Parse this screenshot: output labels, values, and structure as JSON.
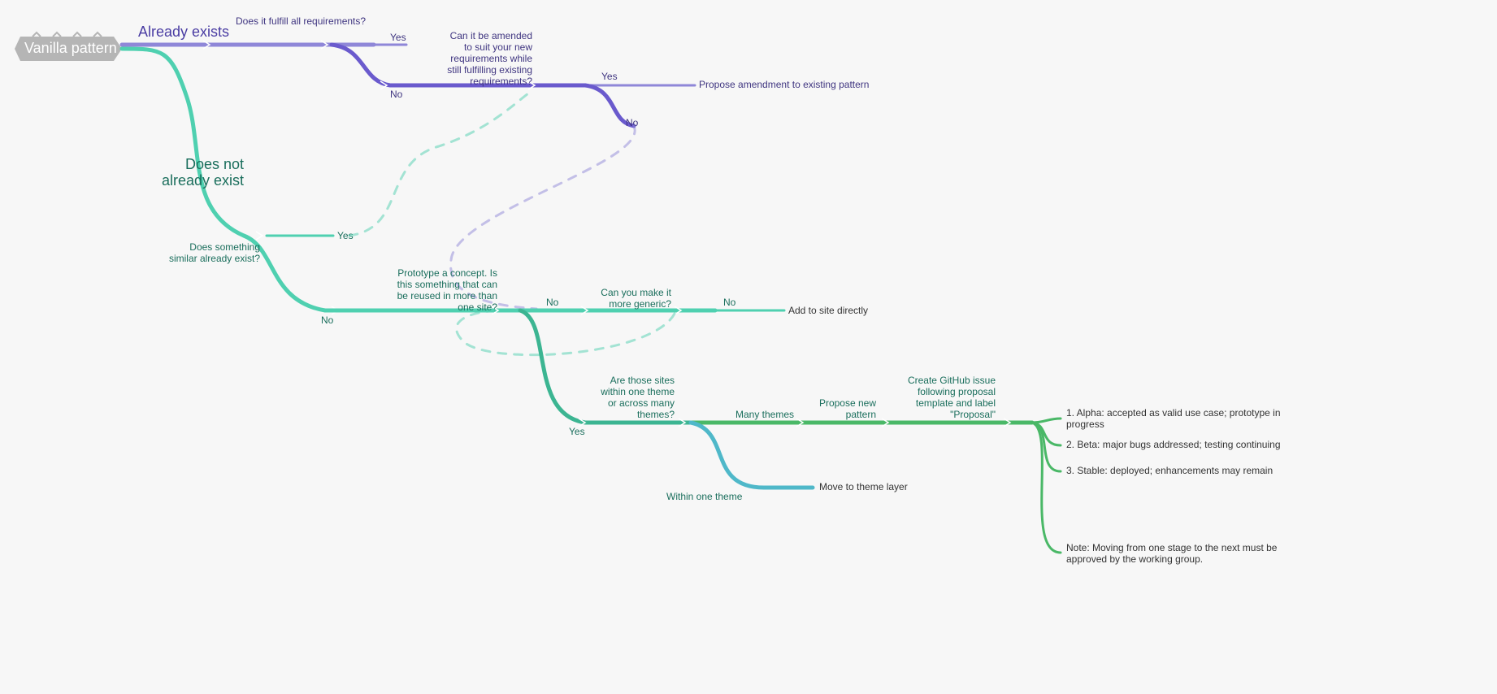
{
  "root": {
    "label": "Vanilla pattern"
  },
  "branch_exists": {
    "label": "Already exists",
    "q_fulfill": "Does it fulfill all requirements?",
    "yes1": "Yes",
    "q_amend_l1": "Can it be amended",
    "q_amend_l2": "to suit your new",
    "q_amend_l3": "requirements while",
    "q_amend_l4": "still fulfilling existing",
    "q_amend_l5": "requirements?",
    "no1": "No",
    "yes2": "Yes",
    "no2": "No",
    "propose_amend": "Propose amendment to existing pattern"
  },
  "branch_notexists": {
    "label_l1": "Does not",
    "label_l2": "already exist",
    "q_similar_l1": "Does something",
    "q_similar_l2": "similar already exist?",
    "yes": "Yes",
    "no": "No",
    "q_proto_l1": "Prototype a concept. Is",
    "q_proto_l2": "this something that can",
    "q_proto_l3": "be reused in more than",
    "q_proto_l4": "one site?",
    "q_generic_l1": "Can you make it",
    "q_generic_l2": "more generic?",
    "no2": "No",
    "no3": "No",
    "add_site": "Add to site directly",
    "yes2": "Yes",
    "q_themes_l1": "Are those sites",
    "q_themes_l2": "within one theme",
    "q_themes_l3": "or across many",
    "q_themes_l4": "themes?",
    "many": "Many themes",
    "within": "Within one theme",
    "move_theme": "Move to theme layer",
    "propose_new_l1": "Propose new",
    "propose_new_l2": "pattern",
    "github_l1": "Create GitHub issue",
    "github_l2": "following proposal",
    "github_l3": "template and label",
    "github_l4": "\"Proposal\""
  },
  "stages": {
    "alpha_l1": "1. Alpha: accepted as valid use case; prototype in",
    "alpha_l2": "progress",
    "beta": "2. Beta: major bugs addressed; testing continuing",
    "stable": "3. Stable: deployed; enhancements may remain",
    "note_l1": "Note: Moving from one stage to the next must be",
    "note_l2": "approved by the working group."
  }
}
